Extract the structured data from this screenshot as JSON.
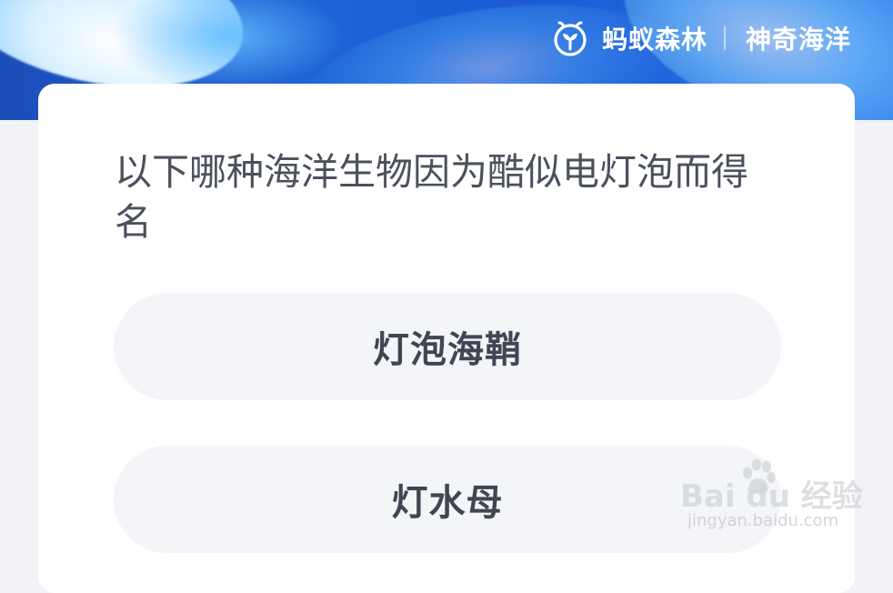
{
  "header": {
    "brand_name": "蚂蚁森林",
    "subtitle": "神奇海洋",
    "logo_icon": "ant-forest-logo-icon"
  },
  "question": {
    "text": "以下哪种海洋生物因为酷似电灯泡而得名"
  },
  "options": [
    {
      "label": "灯泡海鞘"
    },
    {
      "label": "灯水母"
    }
  ],
  "watermark": {
    "main": "Bai du 经验",
    "sub": "jingyan.baidu.com"
  },
  "colors": {
    "banner_blue": "#1f63d6",
    "card_bg": "#ffffff",
    "page_bg": "#f1f3f7",
    "option_bg": "#f3f5f8",
    "question_text": "#4b515c",
    "option_text": "#404652"
  }
}
